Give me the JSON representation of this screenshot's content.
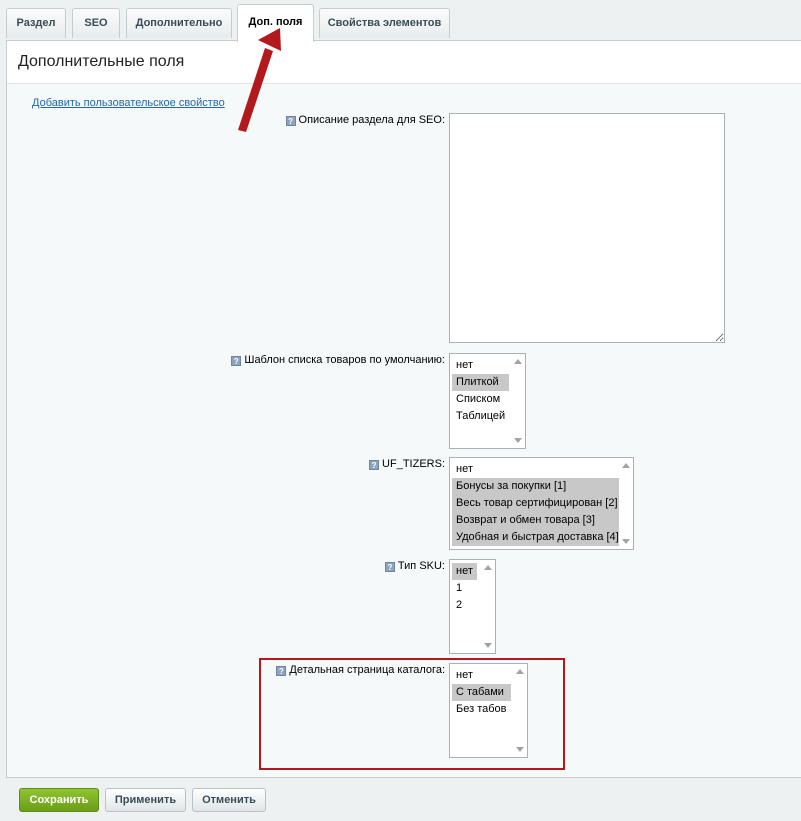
{
  "tabs": [
    {
      "label": "Раздел",
      "active": false
    },
    {
      "label": "SEO",
      "active": false
    },
    {
      "label": "Дополнительно",
      "active": false
    },
    {
      "label": "Доп. поля",
      "active": true
    },
    {
      "label": "Свойства элементов",
      "active": false
    }
  ],
  "panel": {
    "title": "Дополнительные поля",
    "add_link": "Добавить пользовательское свойство",
    "hint_glyph": "?"
  },
  "fields": {
    "seo_description": {
      "label": "Описание раздела для SEO:",
      "value": ""
    },
    "list_template": {
      "label": "Шаблон списка товаров по умолчанию:",
      "options": [
        {
          "text": "нет",
          "selected": false
        },
        {
          "text": "Плиткой",
          "selected": true
        },
        {
          "text": "Списком",
          "selected": false
        },
        {
          "text": "Таблицей",
          "selected": false
        }
      ]
    },
    "uf_tizers": {
      "label": "UF_TIZERS:",
      "options": [
        {
          "text": "нет",
          "selected": false
        },
        {
          "text": "Бонусы за покупки [1]",
          "selected": true
        },
        {
          "text": "Весь товар сертифицирован [2]",
          "selected": true
        },
        {
          "text": "Возврат и обмен товара [3]",
          "selected": true
        },
        {
          "text": "Удобная и быстрая доставка [4]",
          "selected": true
        }
      ]
    },
    "sku_type": {
      "label": "Тип SKU:",
      "options": [
        {
          "text": "нет",
          "selected": true
        },
        {
          "text": "1",
          "selected": false
        },
        {
          "text": "2",
          "selected": false
        }
      ]
    },
    "catalog_detail": {
      "label": "Детальная страница каталога:",
      "options": [
        {
          "text": "нет",
          "selected": false
        },
        {
          "text": "С табами",
          "selected": true
        },
        {
          "text": "Без табов",
          "selected": false
        }
      ]
    }
  },
  "footer": {
    "save_label": "Сохранить",
    "apply_label": "Применить",
    "cancel_label": "Отменить"
  },
  "colors": {
    "annotation": "#b3181d",
    "save_button": "#7fb128",
    "link": "#2067b0"
  },
  "icons": {
    "hint": "question-hint-icon",
    "annotation": "red-arrow-pointer"
  }
}
